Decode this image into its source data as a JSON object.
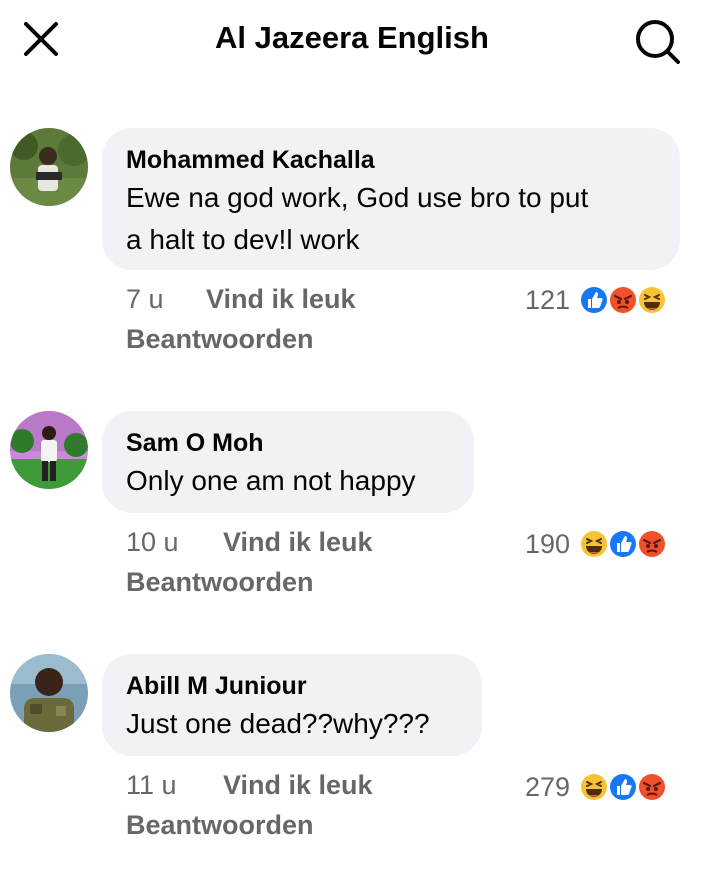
{
  "header": {
    "title": "Al Jazeera English",
    "close_icon": "close-icon",
    "search_icon": "search-icon"
  },
  "comments": [
    {
      "author": "Mohammed Kachalla",
      "text_lines": [
        "Ewe na god work, God use bro to put",
        "a halt to dev!l work"
      ],
      "time": "7 u",
      "like_label": "Vind ik leuk",
      "reply_label": "Beantwoorden",
      "reaction_count": "121",
      "reactions": [
        "like-icon",
        "angry-icon",
        "haha-icon"
      ]
    },
    {
      "author": "Sam O Moh",
      "text_lines": [
        "Only one am not happy"
      ],
      "time": "10 u",
      "like_label": "Vind ik leuk",
      "reply_label": "Beantwoorden",
      "reaction_count": "190",
      "reactions": [
        "haha-icon",
        "like-icon",
        "angry-icon"
      ]
    },
    {
      "author": "Abill M Juniour",
      "text_lines": [
        "Just one dead??why???"
      ],
      "time": "11 u",
      "like_label": "Vind ik leuk",
      "reply_label": "Beantwoorden",
      "reaction_count": "279",
      "reactions": [
        "haha-icon",
        "like-icon",
        "angry-icon"
      ]
    }
  ],
  "colors": {
    "background": "#ffffff",
    "bubble": "#f0f2f5",
    "secondary_text": "#65676b",
    "like_blue": "#1877f2",
    "angry_orange": "#f0512c",
    "haha_yellow": "#f7c233"
  }
}
